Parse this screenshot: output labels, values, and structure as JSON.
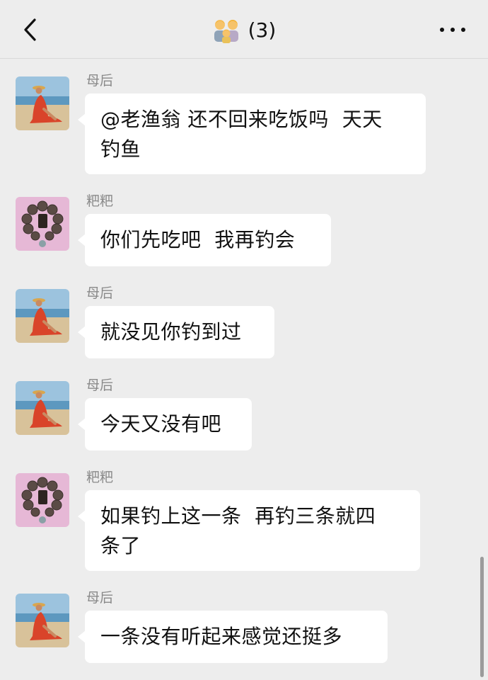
{
  "header": {
    "title_emoji": "👨‍👩‍👦",
    "title_count": "(3)",
    "back_icon": "chevron-left-icon",
    "more_icon": "more-dots-icon"
  },
  "colors": {
    "background": "#ededed",
    "bubble": "#ffffff",
    "sender_text": "#8a8a8a"
  },
  "messages": [
    {
      "sender": "母后",
      "avatar": "beach-photo-avatar",
      "text": "@老渔翁 还不回来吃饭吗  天天\n钓鱼"
    },
    {
      "sender": "粑粑",
      "avatar": "prayer-beads-avatar",
      "text": "你们先吃吧  我再钓会"
    },
    {
      "sender": "母后",
      "avatar": "beach-photo-avatar",
      "text": "就没见你钓到过"
    },
    {
      "sender": "母后",
      "avatar": "beach-photo-avatar",
      "text": "今天又没有吧"
    },
    {
      "sender": "粑粑",
      "avatar": "prayer-beads-avatar",
      "text": "如果钓上这一条  再钓三条就四\n条了"
    },
    {
      "sender": "母后",
      "avatar": "beach-photo-avatar",
      "text": "一条没有听起来感觉还挺多"
    }
  ]
}
